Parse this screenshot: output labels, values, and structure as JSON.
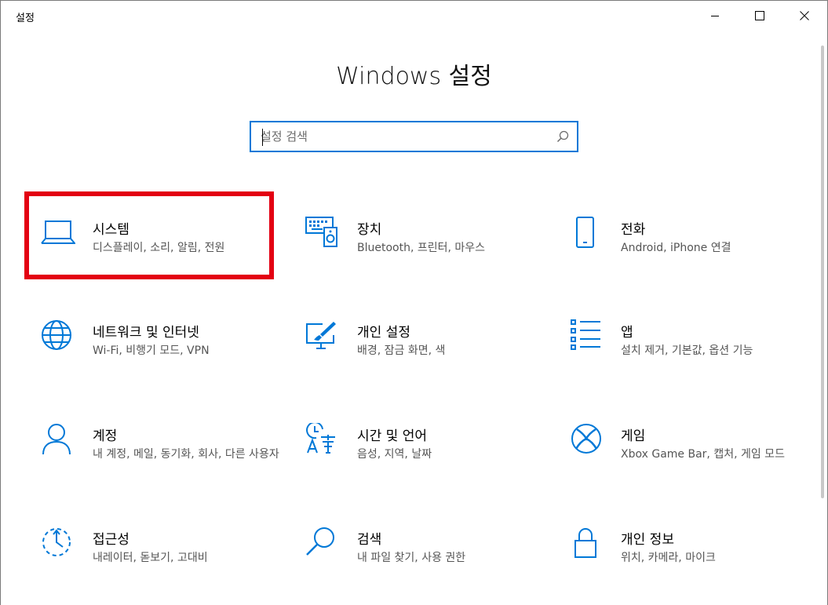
{
  "window": {
    "title": "설정"
  },
  "header": {
    "title": "Windows 설정"
  },
  "search": {
    "placeholder": "설정 검색",
    "value": ""
  },
  "tiles": [
    {
      "key": "system",
      "title": "시스템",
      "desc": "디스플레이, 소리, 알림, 전원",
      "icon": "laptop-icon"
    },
    {
      "key": "devices",
      "title": "장치",
      "desc": "Bluetooth, 프린터, 마우스",
      "icon": "keyboard-speaker-icon"
    },
    {
      "key": "phone",
      "title": "전화",
      "desc": "Android, iPhone 연결",
      "icon": "phone-icon"
    },
    {
      "key": "network",
      "title": "네트워크 및 인터넷",
      "desc": "Wi-Fi, 비행기 모드, VPN",
      "icon": "globe-icon"
    },
    {
      "key": "personalization",
      "title": "개인 설정",
      "desc": "배경, 잠금 화면, 색",
      "icon": "paint-brush-icon"
    },
    {
      "key": "apps",
      "title": "앱",
      "desc": "설치 제거, 기본값, 옵션 기능",
      "icon": "app-list-icon"
    },
    {
      "key": "accounts",
      "title": "계정",
      "desc": "내 계정, 메일, 동기화, 회사, 다른 사용자",
      "icon": "person-icon"
    },
    {
      "key": "time-language",
      "title": "시간 및 언어",
      "desc": "음성, 지역, 날짜",
      "icon": "clock-language-icon"
    },
    {
      "key": "gaming",
      "title": "게임",
      "desc": "Xbox Game Bar, 캡처, 게임 모드",
      "icon": "xbox-icon"
    },
    {
      "key": "ease-of-access",
      "title": "접근성",
      "desc": "내레이터, 돋보기, 고대비",
      "icon": "ease-of-access-icon"
    },
    {
      "key": "search",
      "title": "검색",
      "desc": "내 파일 찾기, 사용 권한",
      "icon": "search-icon"
    },
    {
      "key": "privacy",
      "title": "개인 정보",
      "desc": "위치, 카메라, 마이크",
      "icon": "lock-icon"
    }
  ],
  "colors": {
    "accent": "#0078d7",
    "highlight": "#e30012"
  }
}
